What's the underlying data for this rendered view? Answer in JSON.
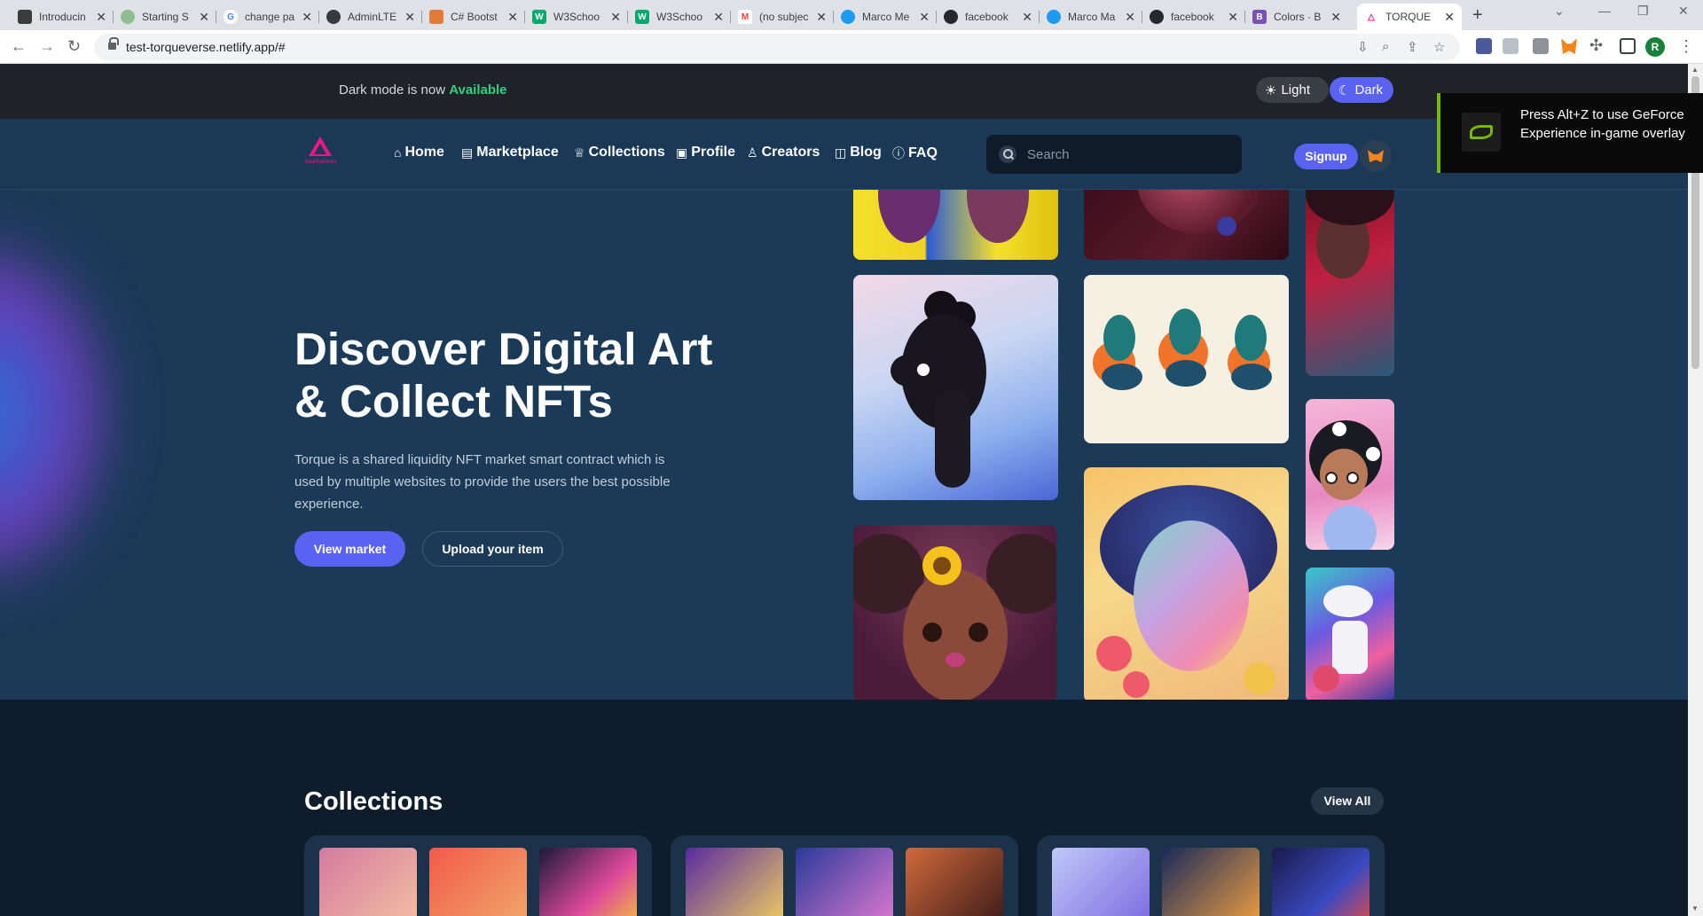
{
  "browser": {
    "tabs": [
      {
        "label": "Introducin",
        "favicon": "#3c3c3c"
      },
      {
        "label": "Starting S",
        "favicon": "#8fbf8f"
      },
      {
        "label": "change pa",
        "favicon": "#4285f4"
      },
      {
        "label": "AdminLTE",
        "favicon": "#343a40"
      },
      {
        "label": "C# Bootst",
        "favicon": "#e07b39"
      },
      {
        "label": "W3Schoo",
        "favicon": "#04aa6d"
      },
      {
        "label": "W3Schoo",
        "favicon": "#04aa6d"
      },
      {
        "label": "(no subjec",
        "favicon": "#ea4335"
      },
      {
        "label": "Marco Me",
        "favicon": "#1d9bf0"
      },
      {
        "label": "facebook",
        "favicon": "#24292f"
      },
      {
        "label": "Marco Ma",
        "favicon": "#1d9bf0"
      },
      {
        "label": "facebook",
        "favicon": "#24292f"
      },
      {
        "label": "Colors · B",
        "favicon": "#7952b3"
      },
      {
        "label": "TORQUE",
        "favicon": "#e7178c"
      }
    ],
    "url": "test-torqueverse.netlify.app/#",
    "profile_initial": "R"
  },
  "announcement": {
    "text": "Dark mode is now",
    "highlight": "Available",
    "light_label": "Light",
    "dark_label": "Dark"
  },
  "nav": {
    "logo_text": "TorqPlatforms",
    "links": [
      {
        "label": "Home",
        "icon": "home-icon"
      },
      {
        "label": "Marketplace",
        "icon": "store-icon"
      },
      {
        "label": "Collections",
        "icon": "crown-icon"
      },
      {
        "label": "Profile",
        "icon": "id-card-icon"
      },
      {
        "label": "Creators",
        "icon": "user-icon"
      },
      {
        "label": "Blog",
        "icon": "book-icon"
      },
      {
        "label": "FAQ",
        "icon": "help-icon"
      }
    ],
    "search_placeholder": "Search",
    "signup_label": "Signup"
  },
  "hero": {
    "title": "Discover Digital Art & Collect NFTs",
    "description": "Torque is a shared liquidity NFT market smart contract which is used by multiple websites to provide the users the best possible experience.",
    "primary_button": "View market",
    "secondary_button": "Upload your item"
  },
  "collections": {
    "title": "Collections",
    "view_all": "View All"
  },
  "overlay": {
    "text": "Press Alt+Z to use GeForce Experience in-game overlay"
  },
  "colors": {
    "accent": "#5a62f1",
    "highlight": "#35d07f",
    "brand": "#e7178c",
    "hero_bg": "#1b3a58"
  }
}
